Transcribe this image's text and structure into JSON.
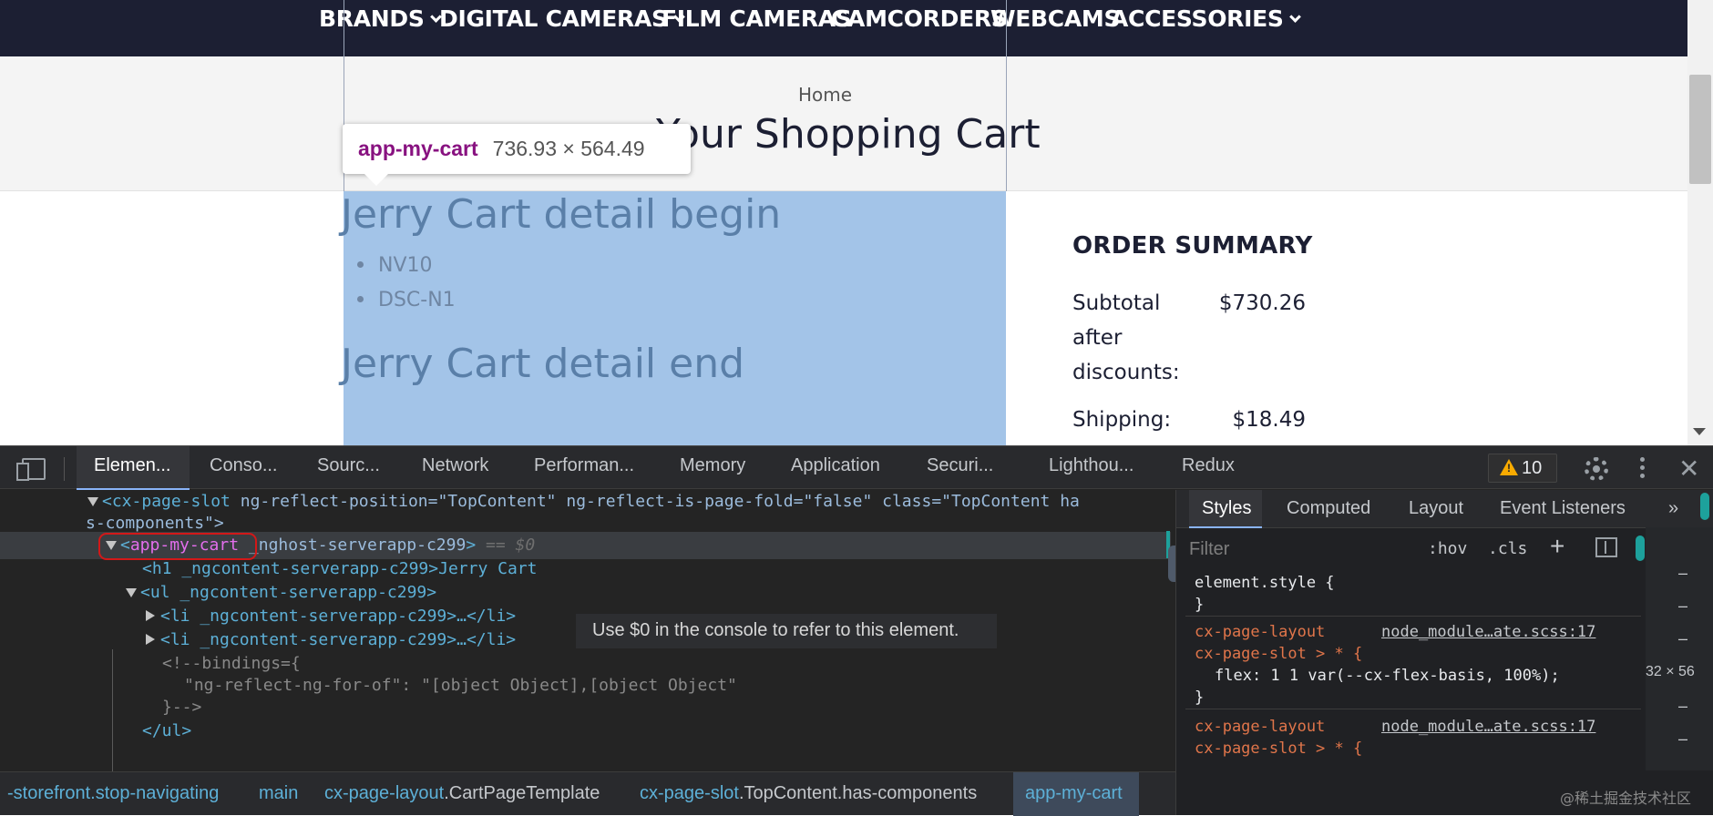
{
  "site": {
    "nav": [
      {
        "label": "BRANDS",
        "dropdown": true
      },
      {
        "label": "DIGITAL CAMERAS",
        "dropdown": true
      },
      {
        "label": "FILM CAMERAS",
        "dropdown": false
      },
      {
        "label": "CAMCORDERS",
        "dropdown": false
      },
      {
        "label": "WEBCAMS",
        "dropdown": false
      },
      {
        "label": "ACCESSORIES",
        "dropdown": true
      }
    ],
    "breadcrumb": "Home",
    "page_title": "Your Shopping Cart",
    "tooltip": {
      "tag": "app-my-cart",
      "dims": "736.93 × 564.49"
    },
    "cart_heading_begin": "Jerry Cart detail begin",
    "cart_items": [
      "NV10",
      "DSC-N1"
    ],
    "cart_heading_end": "Jerry Cart detail end",
    "order_summary": {
      "title": "ORDER SUMMARY",
      "subtotal_label": "Subtotal after discounts:",
      "subtotal_value": "$730.26",
      "shipping_label": "Shipping:",
      "shipping_value": "$18.49"
    }
  },
  "devtools": {
    "tabs": [
      "Elemen...",
      "Conso...",
      "Sourc...",
      "Network",
      "Performan...",
      "Memory",
      "Application",
      "Securi...",
      "Lighthou...",
      "Redux"
    ],
    "warning_count": "10",
    "dom": {
      "line1_tag": "cx-page-slot",
      "line1_attrs": "ng-reflect-position=\"TopContent\" ng-reflect-is-page-fold=\"false\" class=\"TopContent ha",
      "line1_cont": "s-components\">",
      "sel_tag": "app-my-cart",
      "sel_attr": " _nghost-serverapp-c299",
      "sel_dollar": "== $0",
      "h1_line": "<h1 _ngcontent-serverapp-c299>Jerry Cart",
      "ul_line": "<ul _ngcontent-serverapp-c299>",
      "li_line": "<li _ngcontent-serverapp-c299>…</li>",
      "comment1": "<!--bindings={",
      "comment2": "\"ng-reflect-ng-for-of\": \"[object Object],[object Object\"",
      "comment3": "}-->",
      "close_ul": "</ul>"
    },
    "hint": "Use $0 in the console to refer to this element.",
    "breadcrumbs": [
      {
        "k": "",
        "v": "-storefront.stop-navigating"
      },
      {
        "k": "",
        "v": "main"
      },
      {
        "k": "cx-page-layout",
        "v": ".CartPageTemplate"
      },
      {
        "k": "cx-page-slot",
        "v": ".TopContent.has-components"
      },
      {
        "k": "",
        "v": "app-my-cart"
      }
    ],
    "styles_tabs": [
      "Styles",
      "Computed",
      "Layout",
      "Event Listeners"
    ],
    "filter_placeholder": "Filter",
    "hov": ":hov",
    "cls": ".cls",
    "rules": {
      "element_style": "element.style {",
      "close": "}",
      "sel1": "cx-page-layout",
      "sel2": "cx-page-slot > * {",
      "link": "node_module…ate.scss:17",
      "prop": "flex: 1 1 var(--cx-flex-basis, 100%);"
    },
    "side_nums": "32 × 56",
    "watermark": "@稀土掘金技术社区"
  }
}
